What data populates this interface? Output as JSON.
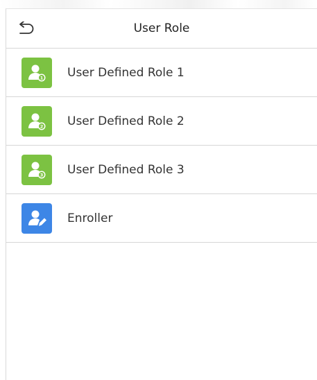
{
  "header": {
    "title": "User Role",
    "back_icon": "back-arrow-icon"
  },
  "roles": [
    {
      "label": "User Defined Role 1",
      "icon": "user-badge-1-icon",
      "color": "#7cc242",
      "badge": "1"
    },
    {
      "label": "User Defined Role 2",
      "icon": "user-badge-2-icon",
      "color": "#7cc242",
      "badge": "2"
    },
    {
      "label": "User Defined Role 3",
      "icon": "user-badge-3-icon",
      "color": "#7cc242",
      "badge": "3"
    },
    {
      "label": "Enroller",
      "icon": "user-edit-icon",
      "color": "#3d86e6"
    }
  ]
}
